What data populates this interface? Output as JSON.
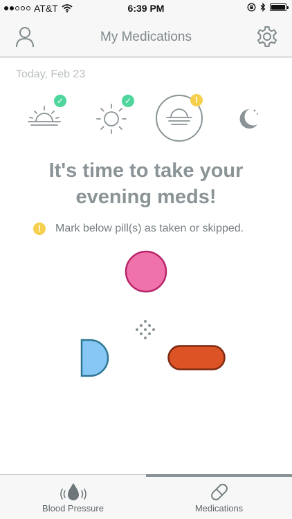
{
  "status_bar": {
    "carrier": "AT&T",
    "time": "6:39 PM"
  },
  "nav": {
    "title": "My Medications",
    "left_icon": "person-icon",
    "right_icon": "gear-icon"
  },
  "date_label": "Today, Feb 23",
  "day_phases": [
    {
      "icon": "sunrise-icon",
      "status": "taken"
    },
    {
      "icon": "sun-icon",
      "status": "taken"
    },
    {
      "icon": "sunset-icon",
      "status": "pending",
      "selected": true
    },
    {
      "icon": "moon-icon",
      "status": "none"
    }
  ],
  "headline": "It's time to take your evening meds!",
  "hint": "Mark below pill(s) as taken or skipped.",
  "pills": [
    {
      "shape": "round",
      "color": "#ef72aa"
    },
    {
      "shape": "half-round",
      "color": "#87c7f5"
    },
    {
      "shape": "capsule",
      "color": "#dc5325"
    }
  ],
  "tabs": [
    {
      "label": "Blood Pressure",
      "icon": "blood-drop-icon",
      "active": false
    },
    {
      "label": "Medications",
      "icon": "pill-icon",
      "active": true
    }
  ],
  "colors": {
    "taken": "#4fd69c",
    "pending": "#f6d04d",
    "text": "#8a9396"
  }
}
